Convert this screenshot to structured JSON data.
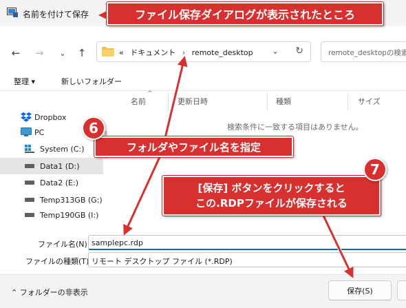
{
  "window": {
    "title": "名前を付けて保存"
  },
  "navigation": {
    "back_icon": "arrow-left-icon",
    "forward_icon": "arrow-right-icon",
    "recent_icon": "chevron-down-icon",
    "up_icon": "arrow-up-icon"
  },
  "address": {
    "root_marker": "«",
    "crumbs": [
      "ドキュメント",
      "remote_desktop"
    ],
    "separator": "›"
  },
  "search": {
    "placeholder": "remote_desktopの検索"
  },
  "commandbar": {
    "organize": "整理 ▾",
    "new_folder": "新しいフォルダー"
  },
  "sidebar": {
    "items": [
      {
        "label": "Dropbox",
        "icon": "dropbox-icon"
      },
      {
        "label": "PC",
        "icon": "pc-icon"
      },
      {
        "label": "System (C:)",
        "icon": "windows-drive-icon"
      },
      {
        "label": "Data1 (D:)",
        "icon": "drive-icon",
        "selected": true
      },
      {
        "label": "Data2 (E:)",
        "icon": "drive-icon"
      },
      {
        "label": "Temp313GB (G:)",
        "icon": "drive-icon"
      },
      {
        "label": "Temp190GB (I:)",
        "icon": "drive-icon"
      }
    ]
  },
  "file_list": {
    "columns": [
      "名前",
      "更新日時",
      "種類",
      "サイズ"
    ],
    "empty_message": "検索条件に一致する項目はありません。"
  },
  "form": {
    "filename_label": "ファイル名(N):",
    "filename_value": "samplepc.rdp",
    "filetype_label": "ファイルの種類(T):",
    "filetype_value": "リモート デスクトップ ファイル (*.RDP)"
  },
  "footer": {
    "hide_folders": "フォルダーの非表示",
    "save_button": "保存(S)"
  },
  "annotations": {
    "title_callout": "ファイル保存ダイアログが表示されたところ",
    "step6_number": "6",
    "step6_text": "フォルダやファイル名を指定",
    "step7_number": "7",
    "step7_line1": "[保存] ボタンをクリックすると",
    "step7_line2": "この.RDPファイルが保存される"
  },
  "colors": {
    "callout_red": "#d7302e",
    "accent_blue": "#0067c0"
  }
}
